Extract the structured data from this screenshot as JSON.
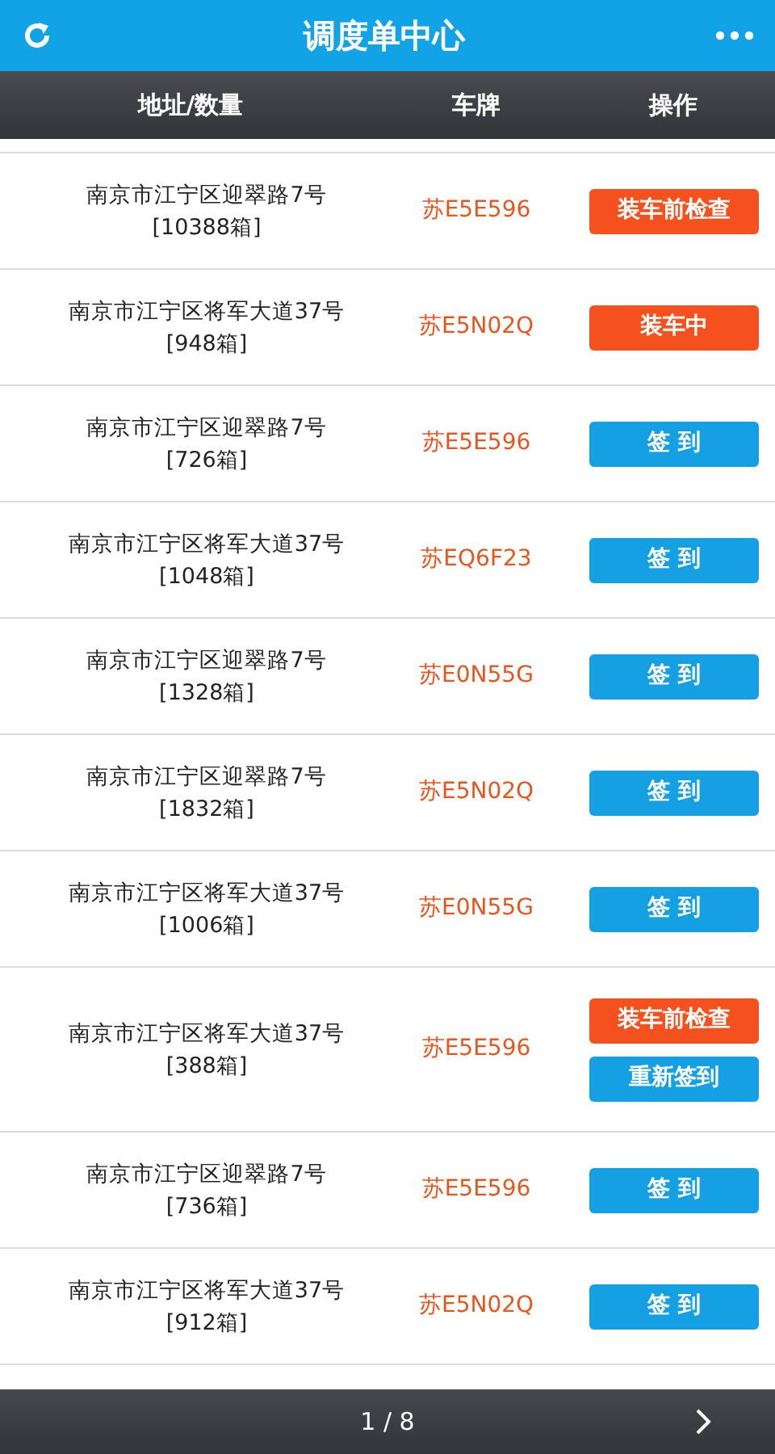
{
  "title": "调度单中心",
  "columns": [
    "地址/数量",
    "车牌",
    "操作"
  ],
  "rows": [
    {
      "address": "南京市江宁区迎翠路7号",
      "quantity": "[10388箱]",
      "plate": "苏E5E596",
      "actions": [
        {
          "label": "装车前检查",
          "kind": "warning"
        }
      ]
    },
    {
      "address": "南京市江宁区将军大道37号",
      "quantity": "[948箱]",
      "plate": "苏E5N02Q",
      "actions": [
        {
          "label": "装车中",
          "kind": "warning"
        }
      ]
    },
    {
      "address": "南京市江宁区迎翠路7号",
      "quantity": "[726箱]",
      "plate": "苏E5E596",
      "actions": [
        {
          "label": "签 到",
          "kind": "primary"
        }
      ]
    },
    {
      "address": "南京市江宁区将军大道37号",
      "quantity": "[1048箱]",
      "plate": "苏EQ6F23",
      "actions": [
        {
          "label": "签 到",
          "kind": "primary"
        }
      ]
    },
    {
      "address": "南京市江宁区迎翠路7号",
      "quantity": "[1328箱]",
      "plate": "苏E0N55G",
      "actions": [
        {
          "label": "签 到",
          "kind": "primary"
        }
      ]
    },
    {
      "address": "南京市江宁区迎翠路7号",
      "quantity": "[1832箱]",
      "plate": "苏E5N02Q",
      "actions": [
        {
          "label": "签 到",
          "kind": "primary"
        }
      ]
    },
    {
      "address": "南京市江宁区将军大道37号",
      "quantity": "[1006箱]",
      "plate": "苏E0N55G",
      "actions": [
        {
          "label": "签 到",
          "kind": "primary"
        }
      ]
    },
    {
      "address": "南京市江宁区将军大道37号",
      "quantity": "[388箱]",
      "plate": "苏E5E596",
      "actions": [
        {
          "label": "装车前检查",
          "kind": "warning"
        },
        {
          "label": "重新签到",
          "kind": "primary"
        }
      ]
    },
    {
      "address": "南京市江宁区迎翠路7号",
      "quantity": "[736箱]",
      "plate": "苏E5E596",
      "actions": [
        {
          "label": "签 到",
          "kind": "primary"
        }
      ]
    },
    {
      "address": "南京市江宁区将军大道37号",
      "quantity": "[912箱]",
      "plate": "苏E5N02Q",
      "actions": [
        {
          "label": "签 到",
          "kind": "primary"
        }
      ]
    }
  ],
  "pager": "1 / 8"
}
